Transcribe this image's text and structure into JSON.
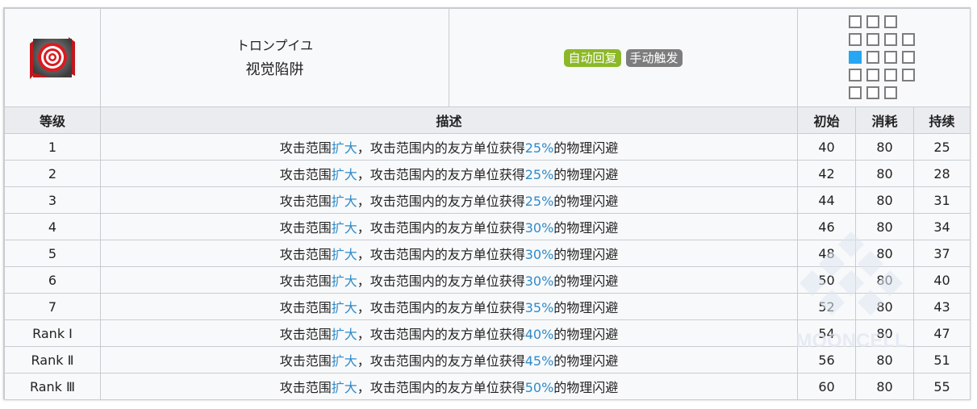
{
  "skill": {
    "name_jp": "トロンプイユ",
    "name_cn": "视觉陷阱",
    "recovery_type": "自动回复",
    "trigger_type": "手动触发",
    "icon": "skill-icon-red-spiral",
    "colors": {
      "auto_badge": "#8cb827",
      "manual_badge": "#7d7d7d",
      "highlight": "#2e8bcb",
      "range_self": "#27a6f3"
    }
  },
  "range_grid": {
    "rows": [
      [
        1,
        1,
        1,
        0
      ],
      [
        1,
        1,
        1,
        1
      ],
      [
        2,
        1,
        1,
        1
      ],
      [
        1,
        1,
        1,
        1
      ],
      [
        1,
        1,
        1,
        0
      ]
    ]
  },
  "table": {
    "headers": {
      "level": "等级",
      "description": "描述",
      "initial": "初始",
      "cost": "消耗",
      "duration": "持续"
    },
    "rows": [
      {
        "level": "1",
        "desc_pre": "攻击范围",
        "desc_hl1": "扩大",
        "desc_mid": "，攻击范围内的友方单位获得",
        "desc_hl2": "25%",
        "desc_post": "的物理闪避",
        "initial": "40",
        "cost": "80",
        "duration": "25"
      },
      {
        "level": "2",
        "desc_pre": "攻击范围",
        "desc_hl1": "扩大",
        "desc_mid": "，攻击范围内的友方单位获得",
        "desc_hl2": "25%",
        "desc_post": "的物理闪避",
        "initial": "42",
        "cost": "80",
        "duration": "28"
      },
      {
        "level": "3",
        "desc_pre": "攻击范围",
        "desc_hl1": "扩大",
        "desc_mid": "，攻击范围内的友方单位获得",
        "desc_hl2": "25%",
        "desc_post": "的物理闪避",
        "initial": "44",
        "cost": "80",
        "duration": "31"
      },
      {
        "level": "4",
        "desc_pre": "攻击范围",
        "desc_hl1": "扩大",
        "desc_mid": "，攻击范围内的友方单位获得",
        "desc_hl2": "30%",
        "desc_post": "的物理闪避",
        "initial": "46",
        "cost": "80",
        "duration": "34"
      },
      {
        "level": "5",
        "desc_pre": "攻击范围",
        "desc_hl1": "扩大",
        "desc_mid": "，攻击范围内的友方单位获得",
        "desc_hl2": "30%",
        "desc_post": "的物理闪避",
        "initial": "48",
        "cost": "80",
        "duration": "37"
      },
      {
        "level": "6",
        "desc_pre": "攻击范围",
        "desc_hl1": "扩大",
        "desc_mid": "，攻击范围内的友方单位获得",
        "desc_hl2": "30%",
        "desc_post": "的物理闪避",
        "initial": "50",
        "cost": "80",
        "duration": "40"
      },
      {
        "level": "7",
        "desc_pre": "攻击范围",
        "desc_hl1": "扩大",
        "desc_mid": "，攻击范围内的友方单位获得",
        "desc_hl2": "35%",
        "desc_post": "的物理闪避",
        "initial": "52",
        "cost": "80",
        "duration": "43"
      },
      {
        "level": "Rank Ⅰ",
        "desc_pre": "攻击范围",
        "desc_hl1": "扩大",
        "desc_mid": "，攻击范围内的友方单位获得",
        "desc_hl2": "40%",
        "desc_post": "的物理闪避",
        "initial": "54",
        "cost": "80",
        "duration": "47"
      },
      {
        "level": "Rank Ⅱ",
        "desc_pre": "攻击范围",
        "desc_hl1": "扩大",
        "desc_mid": "，攻击范围内的友方单位获得",
        "desc_hl2": "45%",
        "desc_post": "的物理闪避",
        "initial": "56",
        "cost": "80",
        "duration": "51"
      },
      {
        "level": "Rank Ⅲ",
        "desc_pre": "攻击范围",
        "desc_hl1": "扩大",
        "desc_mid": "，攻击范围内的友方单位获得",
        "desc_hl2": "50%",
        "desc_post": "的物理闪避",
        "initial": "60",
        "cost": "80",
        "duration": "55"
      }
    ]
  },
  "watermark": {
    "text": "MOONCELL"
  }
}
